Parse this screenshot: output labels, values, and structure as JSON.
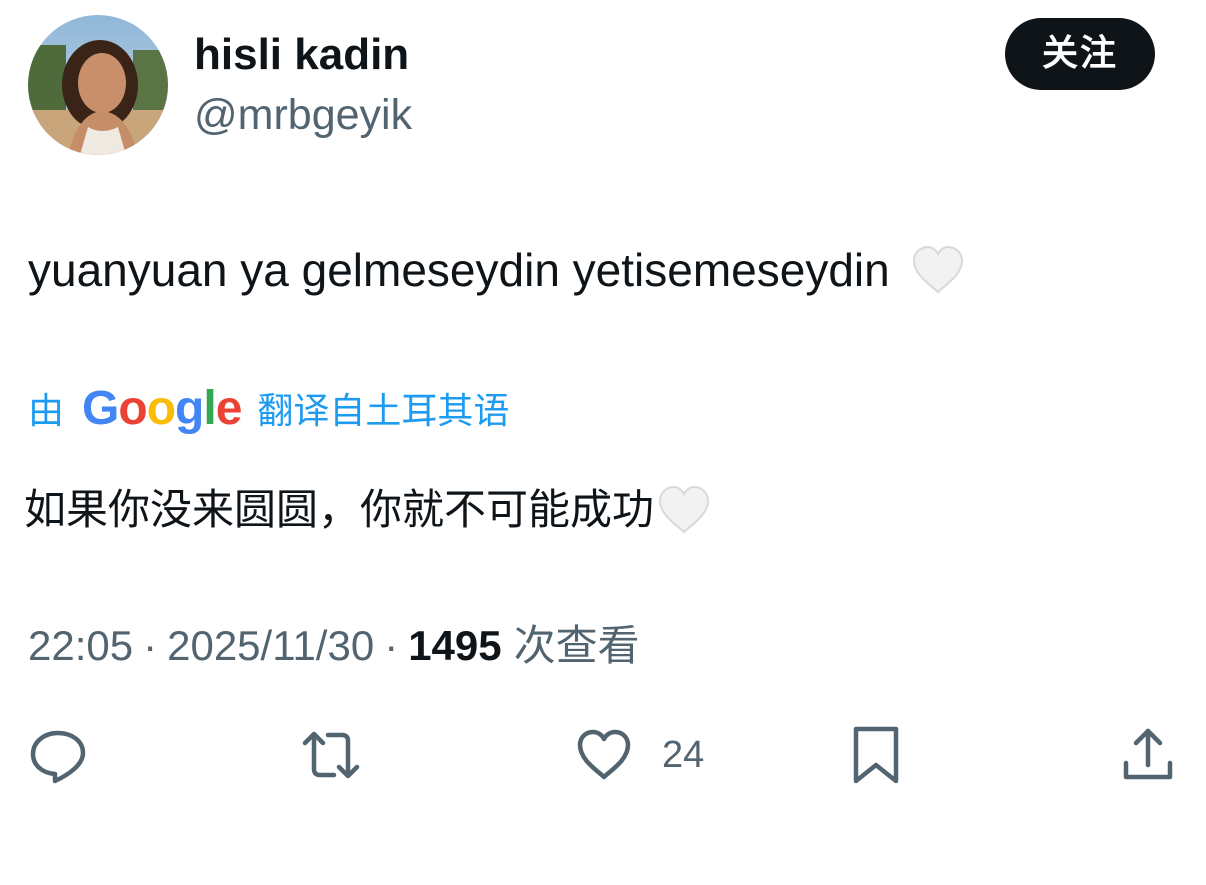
{
  "author": {
    "display_name": "hisli kadin",
    "handle": "@mrbgeyik",
    "avatar_icon": "profile-photo"
  },
  "follow_label": "关注",
  "tweet": {
    "text": "yuanyuan ya gelmeseydin yetisemeseydin",
    "emoji": "white-heart"
  },
  "translation": {
    "prefix": "由",
    "provider": "Google",
    "suffix": "翻译自土耳其语",
    "text": "如果你没来圆圆，你就不可能成功",
    "emoji": "white-heart"
  },
  "meta": {
    "time": "22:05",
    "separator": "·",
    "date": "2025/11/30",
    "views": "1495",
    "views_label": "次查看"
  },
  "actions": {
    "reply_icon": "reply-icon",
    "retweet_icon": "retweet-icon",
    "like_icon": "heart-icon",
    "like_count": "24",
    "bookmark_icon": "bookmark-icon",
    "share_icon": "share-icon"
  },
  "colors": {
    "text": "#0f1419",
    "secondary": "#536471",
    "link": "#1d9bf0",
    "button_bg": "#0f1419",
    "google_blue": "#4285f4",
    "google_red": "#ea4335",
    "google_yellow": "#fbbc05",
    "google_green": "#34a853"
  }
}
